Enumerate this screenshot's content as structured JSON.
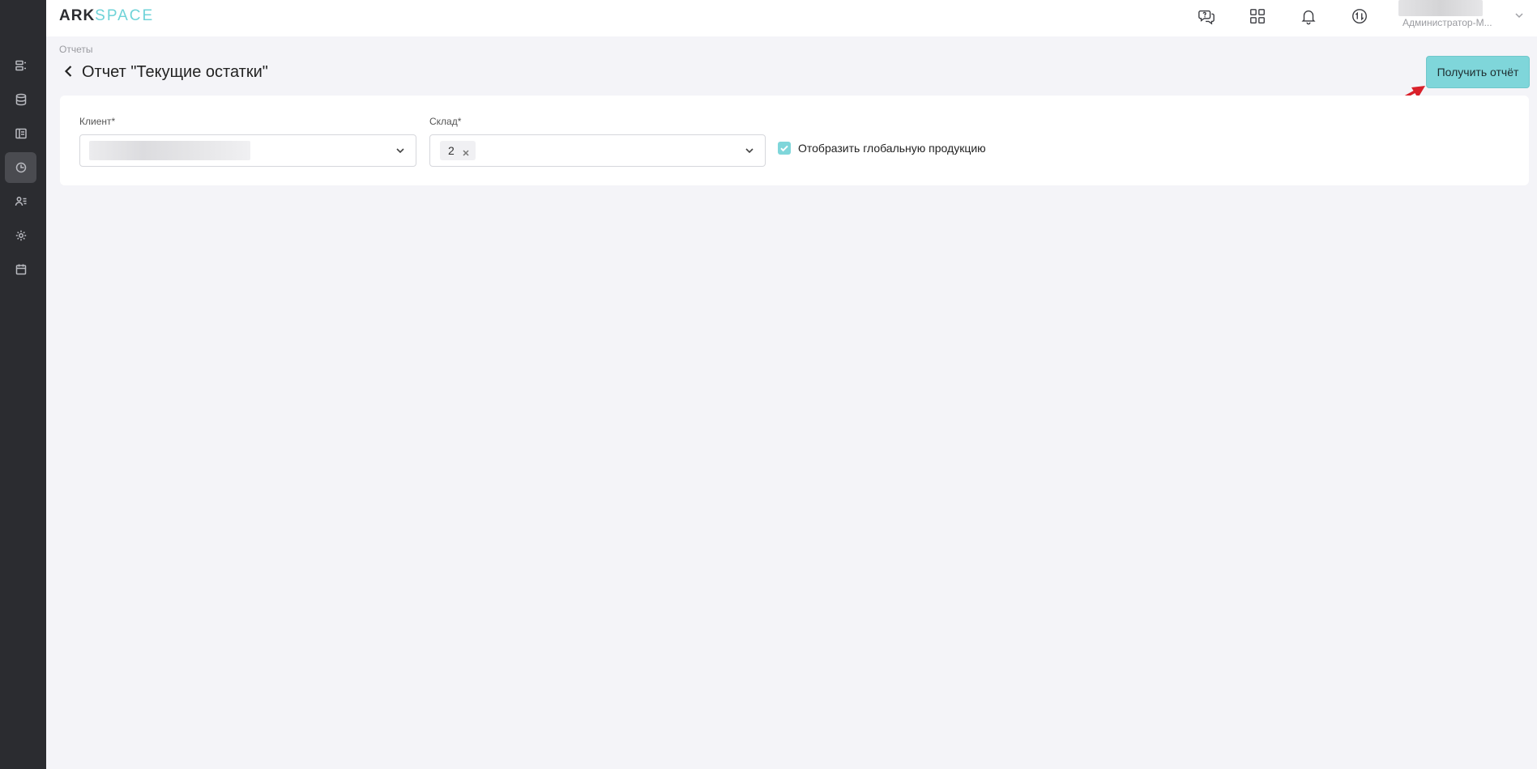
{
  "app": {
    "logo_part1": "ARK",
    "logo_part2": "SPACE"
  },
  "sidebar": {
    "items": [
      {
        "icon": "list-icon",
        "active": false
      },
      {
        "icon": "database-icon",
        "active": false
      },
      {
        "icon": "layout-icon",
        "active": false
      },
      {
        "icon": "clock-chart-icon",
        "active": true
      },
      {
        "icon": "users-icon",
        "active": false
      },
      {
        "icon": "gear-icon",
        "active": false
      },
      {
        "icon": "calendar-icon",
        "active": false
      }
    ]
  },
  "header": {
    "icons": [
      "support-chat-icon",
      "apps-grid-icon",
      "bell-icon",
      "sync-icon"
    ],
    "user_role": "Администратор-М..."
  },
  "breadcrumb": "Отчеты",
  "page_title": "Отчет \"Текущие остатки\"",
  "get_report_label": "Получить отчёт",
  "form": {
    "client_label": "Клиент*",
    "warehouse_label": "Склад*",
    "warehouse_selected": "2",
    "global_products_label": "Отобразить глобальную продукцию",
    "global_products_checked": true
  },
  "colors": {
    "accent": "#7fd6da",
    "sidebar_bg": "#2b2c30",
    "annotation_arrow": "#d9202a"
  }
}
